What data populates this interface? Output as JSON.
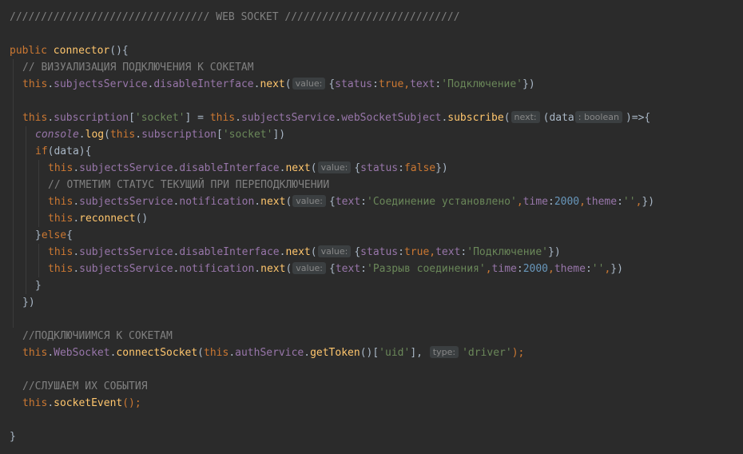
{
  "palette": {
    "background": "#2b2b2b",
    "default": "#a9b7c6",
    "keyword": "#cc7832",
    "method": "#ffc66d",
    "field": "#9876aa",
    "string": "#6a8759",
    "number": "#6897bb",
    "comment": "#808080",
    "hint_bg": "#3b3f41",
    "hint_fg": "#878787"
  },
  "code": {
    "lines": [
      {
        "indent": 0,
        "tokens": [
          {
            "t": "//////////////////////////////// WEB SOCKET ////////////////////////////",
            "c": "comment"
          }
        ]
      },
      {
        "indent": 0,
        "tokens": []
      },
      {
        "indent": 0,
        "tokens": [
          {
            "t": "public ",
            "c": "keyword"
          },
          {
            "t": "connector",
            "c": "method"
          },
          {
            "t": "(){",
            "c": "default"
          }
        ]
      },
      {
        "indent": 1,
        "tokens": [
          {
            "t": "// ВИЗУАЛИЗАЦИЯ ПОДКЛЮЧЕНИЯ К СОКЕТАМ",
            "c": "comment"
          }
        ]
      },
      {
        "indent": 1,
        "tokens": [
          {
            "t": "this",
            "c": "keyword"
          },
          {
            "t": ".",
            "c": "default"
          },
          {
            "t": "subjectsService",
            "c": "field"
          },
          {
            "t": ".",
            "c": "default"
          },
          {
            "t": "disableInterface",
            "c": "field"
          },
          {
            "t": ".",
            "c": "default"
          },
          {
            "t": "next",
            "c": "method"
          },
          {
            "t": "(",
            "c": "default"
          },
          {
            "hint": "value:"
          },
          {
            "t": "{",
            "c": "default"
          },
          {
            "t": "status",
            "c": "field"
          },
          {
            "t": ":",
            "c": "default"
          },
          {
            "t": "true",
            "c": "keyword"
          },
          {
            "t": ",",
            "c": "keyword"
          },
          {
            "t": "text",
            "c": "field"
          },
          {
            "t": ":",
            "c": "default"
          },
          {
            "t": "'Подключение'",
            "c": "string"
          },
          {
            "t": "})",
            "c": "default"
          }
        ]
      },
      {
        "indent": 0,
        "tokens": []
      },
      {
        "indent": 1,
        "tokens": [
          {
            "t": "this",
            "c": "keyword"
          },
          {
            "t": ".",
            "c": "default"
          },
          {
            "t": "subscription",
            "c": "field"
          },
          {
            "t": "[",
            "c": "default"
          },
          {
            "t": "'socket'",
            "c": "string"
          },
          {
            "t": "] = ",
            "c": "default"
          },
          {
            "t": "this",
            "c": "keyword"
          },
          {
            "t": ".",
            "c": "default"
          },
          {
            "t": "subjectsService",
            "c": "field"
          },
          {
            "t": ".",
            "c": "default"
          },
          {
            "t": "webSocketSubject",
            "c": "field"
          },
          {
            "t": ".",
            "c": "default"
          },
          {
            "t": "subscribe",
            "c": "method"
          },
          {
            "t": "(",
            "c": "default"
          },
          {
            "hint": "next:"
          },
          {
            "t": "(data",
            "c": "default"
          },
          {
            "hint": ": boolean"
          },
          {
            "t": ")=>{",
            "c": "default"
          }
        ]
      },
      {
        "indent": 2,
        "tokens": [
          {
            "t": "console",
            "c": "field",
            "italic": true
          },
          {
            "t": ".",
            "c": "default"
          },
          {
            "t": "log",
            "c": "method"
          },
          {
            "t": "(",
            "c": "default"
          },
          {
            "t": "this",
            "c": "keyword"
          },
          {
            "t": ".",
            "c": "default"
          },
          {
            "t": "subscription",
            "c": "field"
          },
          {
            "t": "[",
            "c": "default"
          },
          {
            "t": "'socket'",
            "c": "string"
          },
          {
            "t": "])",
            "c": "default"
          }
        ]
      },
      {
        "indent": 2,
        "tokens": [
          {
            "t": "if",
            "c": "keyword"
          },
          {
            "t": "(data){",
            "c": "default"
          }
        ]
      },
      {
        "indent": 3,
        "tokens": [
          {
            "t": "this",
            "c": "keyword"
          },
          {
            "t": ".",
            "c": "default"
          },
          {
            "t": "subjectsService",
            "c": "field"
          },
          {
            "t": ".",
            "c": "default"
          },
          {
            "t": "disableInterface",
            "c": "field"
          },
          {
            "t": ".",
            "c": "default"
          },
          {
            "t": "next",
            "c": "method"
          },
          {
            "t": "(",
            "c": "default"
          },
          {
            "hint": "value:"
          },
          {
            "t": "{",
            "c": "default"
          },
          {
            "t": "status",
            "c": "field"
          },
          {
            "t": ":",
            "c": "default"
          },
          {
            "t": "false",
            "c": "keyword"
          },
          {
            "t": "})",
            "c": "default"
          }
        ]
      },
      {
        "indent": 3,
        "tokens": [
          {
            "t": "// ОТМЕТИМ СТАТУС ТЕКУЩИЙ ПРИ ПЕРЕПОДКЛЮЧЕНИИ",
            "c": "comment"
          }
        ]
      },
      {
        "indent": 3,
        "tokens": [
          {
            "t": "this",
            "c": "keyword"
          },
          {
            "t": ".",
            "c": "default"
          },
          {
            "t": "subjectsService",
            "c": "field"
          },
          {
            "t": ".",
            "c": "default"
          },
          {
            "t": "notification",
            "c": "field"
          },
          {
            "t": ".",
            "c": "default"
          },
          {
            "t": "next",
            "c": "method"
          },
          {
            "t": "(",
            "c": "default"
          },
          {
            "hint": "value:"
          },
          {
            "t": "{",
            "c": "default"
          },
          {
            "t": "text",
            "c": "field"
          },
          {
            "t": ":",
            "c": "default"
          },
          {
            "t": "'Соединение установлено'",
            "c": "string"
          },
          {
            "t": ",",
            "c": "keyword"
          },
          {
            "t": "time",
            "c": "field"
          },
          {
            "t": ":",
            "c": "default"
          },
          {
            "t": "2000",
            "c": "number"
          },
          {
            "t": ",",
            "c": "keyword"
          },
          {
            "t": "theme",
            "c": "field"
          },
          {
            "t": ":",
            "c": "default"
          },
          {
            "t": "''",
            "c": "string"
          },
          {
            "t": ",",
            "c": "keyword"
          },
          {
            "t": "})",
            "c": "default"
          }
        ]
      },
      {
        "indent": 3,
        "tokens": [
          {
            "t": "this",
            "c": "keyword"
          },
          {
            "t": ".",
            "c": "default"
          },
          {
            "t": "reconnect",
            "c": "method"
          },
          {
            "t": "()",
            "c": "default"
          }
        ]
      },
      {
        "indent": 2,
        "tokens": [
          {
            "t": "}",
            "c": "default"
          },
          {
            "t": "else",
            "c": "keyword"
          },
          {
            "t": "{",
            "c": "default"
          }
        ]
      },
      {
        "indent": 3,
        "tokens": [
          {
            "t": "this",
            "c": "keyword"
          },
          {
            "t": ".",
            "c": "default"
          },
          {
            "t": "subjectsService",
            "c": "field"
          },
          {
            "t": ".",
            "c": "default"
          },
          {
            "t": "disableInterface",
            "c": "field"
          },
          {
            "t": ".",
            "c": "default"
          },
          {
            "t": "next",
            "c": "method"
          },
          {
            "t": "(",
            "c": "default"
          },
          {
            "hint": "value:"
          },
          {
            "t": "{",
            "c": "default"
          },
          {
            "t": "status",
            "c": "field"
          },
          {
            "t": ":",
            "c": "default"
          },
          {
            "t": "true",
            "c": "keyword"
          },
          {
            "t": ",",
            "c": "keyword"
          },
          {
            "t": "text",
            "c": "field"
          },
          {
            "t": ":",
            "c": "default"
          },
          {
            "t": "'Подключение'",
            "c": "string"
          },
          {
            "t": "})",
            "c": "default"
          }
        ]
      },
      {
        "indent": 3,
        "tokens": [
          {
            "t": "this",
            "c": "keyword"
          },
          {
            "t": ".",
            "c": "default"
          },
          {
            "t": "subjectsService",
            "c": "field"
          },
          {
            "t": ".",
            "c": "default"
          },
          {
            "t": "notification",
            "c": "field"
          },
          {
            "t": ".",
            "c": "default"
          },
          {
            "t": "next",
            "c": "method"
          },
          {
            "t": "(",
            "c": "default"
          },
          {
            "hint": "value:"
          },
          {
            "t": "{",
            "c": "default"
          },
          {
            "t": "text",
            "c": "field"
          },
          {
            "t": ":",
            "c": "default"
          },
          {
            "t": "'Разрыв соединения'",
            "c": "string"
          },
          {
            "t": ",",
            "c": "keyword"
          },
          {
            "t": "time",
            "c": "field"
          },
          {
            "t": ":",
            "c": "default"
          },
          {
            "t": "2000",
            "c": "number"
          },
          {
            "t": ",",
            "c": "keyword"
          },
          {
            "t": "theme",
            "c": "field"
          },
          {
            "t": ":",
            "c": "default"
          },
          {
            "t": "''",
            "c": "string"
          },
          {
            "t": ",",
            "c": "keyword"
          },
          {
            "t": "})",
            "c": "default"
          }
        ]
      },
      {
        "indent": 2,
        "tokens": [
          {
            "t": "}",
            "c": "default"
          }
        ]
      },
      {
        "indent": 1,
        "tokens": [
          {
            "t": "})",
            "c": "default"
          }
        ]
      },
      {
        "indent": 0,
        "tokens": []
      },
      {
        "indent": 1,
        "tokens": [
          {
            "t": "//ПОДКЛЮЧИИМСЯ К СОКЕТАМ",
            "c": "comment"
          }
        ]
      },
      {
        "indent": 1,
        "tokens": [
          {
            "t": "this",
            "c": "keyword"
          },
          {
            "t": ".",
            "c": "default"
          },
          {
            "t": "WebSocket",
            "c": "field"
          },
          {
            "t": ".",
            "c": "default"
          },
          {
            "t": "connectSocket",
            "c": "method"
          },
          {
            "t": "(",
            "c": "default"
          },
          {
            "t": "this",
            "c": "keyword"
          },
          {
            "t": ".",
            "c": "default"
          },
          {
            "t": "authService",
            "c": "field"
          },
          {
            "t": ".",
            "c": "default"
          },
          {
            "t": "getToken",
            "c": "method"
          },
          {
            "t": "()[",
            "c": "default"
          },
          {
            "t": "'uid'",
            "c": "string"
          },
          {
            "t": "], ",
            "c": "default"
          },
          {
            "hint": "type:"
          },
          {
            "t": "'driver'",
            "c": "string"
          },
          {
            "t": ");",
            "c": "keyword"
          }
        ]
      },
      {
        "indent": 0,
        "tokens": []
      },
      {
        "indent": 1,
        "tokens": [
          {
            "t": "//СЛУШАЕМ ИХ СОБЫТИЯ",
            "c": "comment"
          }
        ]
      },
      {
        "indent": 1,
        "tokens": [
          {
            "t": "this",
            "c": "keyword"
          },
          {
            "t": ".",
            "c": "default"
          },
          {
            "t": "socketEvent",
            "c": "method"
          },
          {
            "t": "();",
            "c": "keyword"
          }
        ]
      },
      {
        "indent": 0,
        "tokens": []
      },
      {
        "indent": 0,
        "tokens": [
          {
            "t": "}",
            "c": "default"
          }
        ]
      }
    ]
  }
}
